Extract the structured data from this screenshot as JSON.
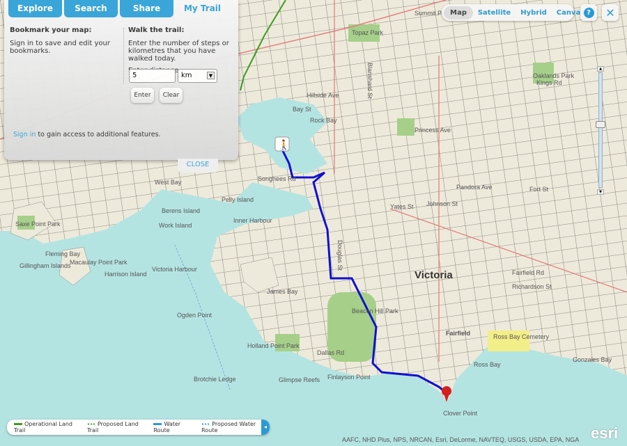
{
  "tabs": [
    {
      "label": "Explore"
    },
    {
      "label": "Search"
    },
    {
      "label": "Share"
    },
    {
      "label": "My Trail",
      "active": true
    }
  ],
  "panel": {
    "bookmark_title": "Bookmark your map:",
    "bookmark_text": "Sign in to save and edit your bookmarks.",
    "walk_title": "Walk the trail:",
    "walk_text": "Enter the number of steps or kilometres that you have walked today.",
    "distance_label": "Enter distance:",
    "distance_value": "5",
    "unit_value": "km",
    "enter_label": "Enter",
    "clear_label": "Clear",
    "signin_link": "Sign in",
    "signin_rest": " to gain access to additional features.",
    "close_label": "CLOSE"
  },
  "basemaps": {
    "items": [
      "Map",
      "Satellite",
      "Hybrid",
      "Canvas"
    ],
    "selected": "Map"
  },
  "icons": {
    "help": "help-icon",
    "fullscreen": "fullscreen-icon",
    "walker": "walker-icon",
    "pin": "map-pin-icon"
  },
  "legend": {
    "items": [
      "Operational Land Trail",
      "Proposed Land Trail",
      "Water Route",
      "Proposed Water Route"
    ],
    "colors": {
      "land": "#3a9e1e",
      "water": "#2a9ad6"
    }
  },
  "zoom_slider": {
    "level": 0.45
  },
  "attribution": "AAFC, NHD Plus, NPS, NRCAN, Esri, DeLorme, NAVTEQ, USGS, USDA, EPA, NGA",
  "logo": "esri",
  "colors": {
    "accent": "#3aa5d8",
    "trail": "#1010d0",
    "water": "#b4e4e2",
    "land": "#efebdc",
    "park": "#a6cf8a"
  },
  "map_labels": {
    "city": "Victoria",
    "places": [
      "James Bay",
      "Fairfield",
      "Ross Bay Cemetery",
      "Beacon Hill Park",
      "Ross Bay",
      "West Bay",
      "Inner Harbour",
      "Victoria Harbour",
      "Rock Bay",
      "Ogden Point",
      "Holland Point Park",
      "Dallas Rd",
      "Finlayson Point",
      "Gonzales Bay",
      "Clover Point",
      "Brotchie Ledge",
      "Glimpse Reefs",
      "Work Island",
      "Berens Island",
      "Pelly Island",
      "Songhees Rd",
      "Gillingham Islands",
      "Macaulay Point Park",
      "Harrison Island",
      "Fleming Bay",
      "Saxe Point Park",
      "Oaklands Park",
      "Topaz Park",
      "Summit Park",
      "Princess Ave",
      "Pandora Ave",
      "Fort St",
      "Yates St",
      "Johnson St",
      "Richardson St",
      "Fairfield Rd",
      "Douglas St",
      "Blanshard St",
      "Hillside Ave",
      "Bay St",
      "Kings Rd"
    ]
  }
}
